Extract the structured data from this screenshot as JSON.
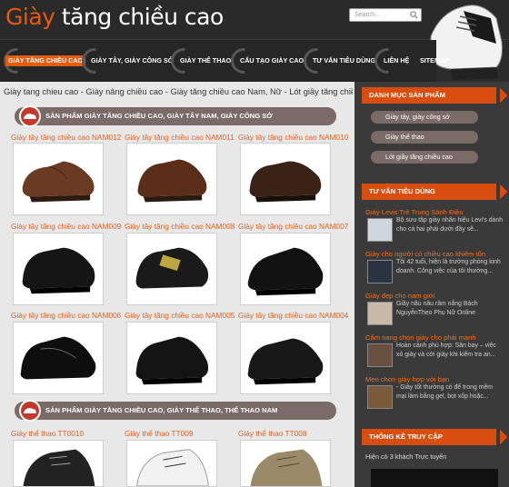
{
  "header": {
    "logo_main": "Giày",
    "logo_rest": " tăng chiều cao",
    "search_placeholder": "Search..."
  },
  "nav": {
    "items": [
      "GIÀY TĂNG CHIỀU CAO",
      "GIÀY TÂY, GIÀY CÔNG SỞ",
      "GIÀY THỂ THAO",
      "CẤU TẠO GIÀY CAO",
      "TƯ VẤN TIÊU DÙNG",
      "LIÊN HỆ",
      "SITEMAP"
    ]
  },
  "breadcrumb": "Giày tang chieu cao - Giày nâng chiều cao - Giày tăng chiều cao Nam, Nữ - Lót giầy tăng chiều cao",
  "sections": [
    {
      "title": "SẢN PHẨM GIÀY TĂNG CHIỀU CAO, GIÀY TÂY NAM, GIÀY CÔNG SỞ"
    },
    {
      "title": "SẢN PHẨM GIÀY TĂNG CHIỀU CAO, GIÀY THỂ THAO, THỂ THAO NAM"
    }
  ],
  "products": [
    "Giày tây tăng chiều cao NAM012",
    "Giày tây tăng chiều cao NAM011",
    "Giày tây tăng chiều cao NAM010",
    "Giày tây tăng chiều cao NAM009",
    "Giày tây tăng chiều cao NAM008",
    "Giày tây tăng chiều cao NAM007",
    "Giày tây tăng chiều cao NAM006",
    "Giày tây tăng chiều cao NAM005",
    "Giày tây tăng chiều cao NAM004"
  ],
  "sport_products": [
    "Giày thể thao TT0010",
    "Giày thể thao TT009",
    "Giày thể thao TT008"
  ],
  "sidebar": {
    "categories_title": "DANH MỤC SẢN PHẨM",
    "categories": [
      "Giày tây, giày công sở",
      "Giày thể thao",
      "Lót giầy tăng chiều cao"
    ],
    "advice_title": "TƯ VẤN TIÊU DÙNG",
    "news": [
      {
        "title": "Giày Levis Trẻ Trung Sành Điệu",
        "text": "Bộ sưu tập giày nhãn hiệu Levi's dành cho cá hai phái dưới đây sẽ..."
      },
      {
        "title": "Giày cho người có chiều cao khiêm tốn",
        "text": "Tôi 42 tuổi, hiện là trưởng phòng kinh doanh. Công việc của tôi thường..."
      },
      {
        "title": "Giày đẹp cho nam giới",
        "text": "Giầy nâu nâu râm nắng Bách NguyễnTheo Phụ Nữ Online"
      },
      {
        "title": "Cẩm nang chọn giày cho phái mạnh",
        "text": "Hoàn cảnh phù hợp: Sân bay – việc xỏ giày và cởi giày khi kiểm tra an..."
      },
      {
        "title": "Mẹo chọn giày hợp với bạn",
        "text": "- Giày tốt thường có đế trong mềm mại làm bằng gel, bọt xốp hoặc..."
      }
    ],
    "stats_title": "THỐNG KÊ TRUY CẬP",
    "online": "Hiện có 3 khách Trực tuyến"
  }
}
